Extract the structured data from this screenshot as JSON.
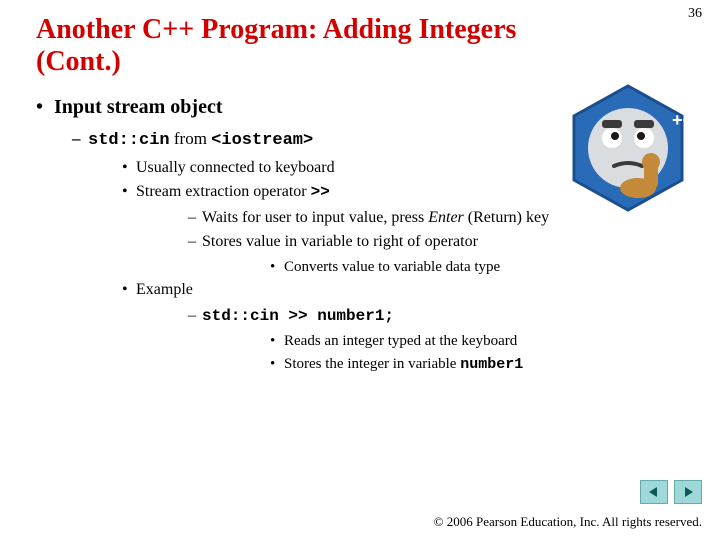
{
  "page_number": "36",
  "title": "Another C++ Program: Adding Integers (Cont.)",
  "content": {
    "h1": "Input stream object",
    "b1_pre": "std::cin",
    "b1_mid": " from ",
    "b1_post": "<iostream>",
    "c1": "Usually connected to keyboard",
    "c2_pre": "Stream extraction operator ",
    "c2_code": ">>",
    "d1_pre": "Waits for user to input value, press ",
    "d1_em": "Enter",
    "d1_post": " (Return) key",
    "d2": "Stores value in variable to right of operator",
    "e1": "Converts value to variable data type",
    "c3": "Example",
    "d3": "std::cin >> number1;",
    "e2": "Reads an integer typed at the keyboard",
    "e3_pre": "Stores the integer in variable ",
    "e3_code": "number1"
  },
  "footer": "© 2006 Pearson Education, Inc.  All rights reserved.",
  "nav": {
    "prev": "prev",
    "next": "next"
  },
  "image_alt": "C++ mascot thinking emoji"
}
